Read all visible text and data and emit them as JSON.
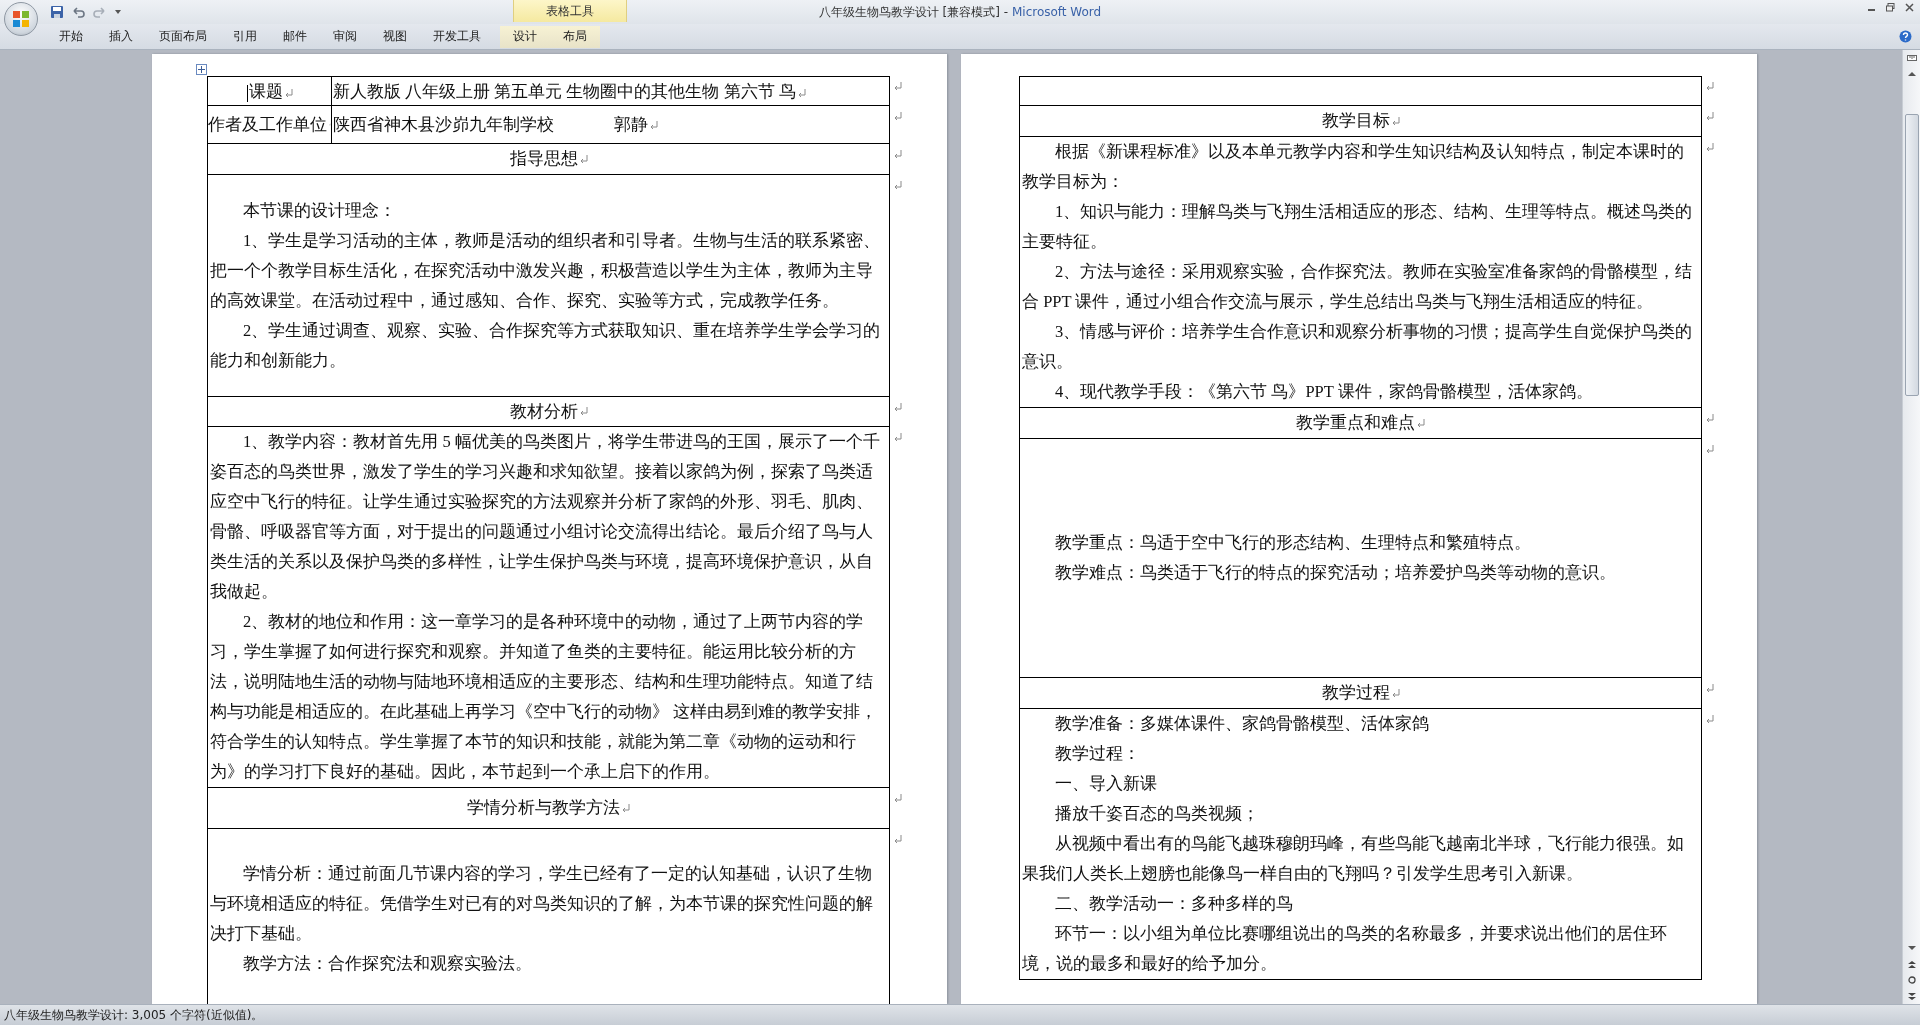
{
  "window": {
    "title": "八年级生物鸟教学设计 [兼容模式] -",
    "app_name": "Microsoft Word"
  },
  "ribbon": {
    "context_group": "表格工具",
    "tabs": [
      {
        "label": "开始",
        "contextual": false
      },
      {
        "label": "插入",
        "contextual": false
      },
      {
        "label": "页面布局",
        "contextual": false
      },
      {
        "label": "引用",
        "contextual": false
      },
      {
        "label": "邮件",
        "contextual": false
      },
      {
        "label": "审阅",
        "contextual": false
      },
      {
        "label": "视图",
        "contextual": false
      },
      {
        "label": "开发工具",
        "contextual": false
      },
      {
        "label": "设计",
        "contextual": true
      },
      {
        "label": "布局",
        "contextual": true
      }
    ]
  },
  "left_page": {
    "title_label": "课题",
    "title_value": "新人教版 八年级上册 第五单元 生物圈中的其他生物 第六节 鸟",
    "author_label": "作者及工作单位",
    "author_unit": "陕西省神木县沙峁九年制学校",
    "author_name": "郭静",
    "sections": [
      {
        "heading": "指导思想",
        "paragraphs": [
          "本节课的设计理念：",
          "1、学生是学习活动的主体，教师是活动的组织者和引导者。生物与生活的联系紧密、把一个个教学目标生活化，在探究活动中激发兴趣，积极营造以学生为主体，教师为主导的高效课堂。在活动过程中，通过感知、合作、探究、实验等方式，完成教学任务。",
          "2、学生通过调查、观察、实验、合作探究等方式获取知识、重在培养学生学会学习的能力和创新能力。"
        ]
      },
      {
        "heading": "教材分析",
        "paragraphs": [
          "1、教学内容：教材首先用 5 幅优美的鸟类图片，将学生带进鸟的王国，展示了一个千姿百态的鸟类世界，激发了学生的学习兴趣和求知欲望。接着以家鸽为例，探索了鸟类适应空中飞行的特征。让学生通过实验探究的方法观察并分析了家鸽的外形、羽毛、肌肉、骨骼、呼吸器官等方面，对于提出的问题通过小组讨论交流得出结论。最后介绍了鸟与人类生活的关系以及保护鸟类的多样性，让学生保护鸟类与环境，提高环境保护意识，从自我做起。",
          "2、教材的地位和作用：这一章学习的是各种环境中的动物，通过了上两节内容的学习，学生掌握了如何进行探究和观察。并知道了鱼类的主要特征。能运用比较分析的方法，说明陆地生活的动物与陆地环境相适应的主要形态、结构和生理功能特点。知道了结构与功能是相适应的。在此基础上再学习《空中飞行的动物》 这样由易到难的教学安排，符合学生的认知特点。学生掌握了本节的知识和技能，就能为第二章《动物的运动和行为》的学习打下良好的基础。因此，本节起到一个承上启下的作用。"
        ]
      },
      {
        "heading": "学情分析与教学方法",
        "paragraphs": [
          "学情分析：通过前面几节课内容的学习，学生已经有了一定的认知基础，认识了生物与环境相适应的特征。凭借学生对已有的对鸟类知识的了解，为本节课的探究性问题的解决打下基础。",
          "教学方法：合作探究法和观察实验法。"
        ]
      }
    ]
  },
  "right_page": {
    "sections": [
      {
        "heading": "教学目标",
        "paragraphs": [
          "根据《新课程标准》以及本单元教学内容和学生知识结构及认知特点，制定本课时的教学目标为：",
          "1、知识与能力：理解鸟类与飞翔生活相适应的形态、结构、生理等特点。概述鸟类的主要特征。",
          "2、方法与途径：采用观察实验，合作探究法。教师在实验室准备家鸽的骨骼模型，结合 PPT 课件，通过小组合作交流与展示，学生总结出鸟类与飞翔生活相适应的特征。",
          "3、情感与评价：培养学生合作意识和观察分析事物的习惯；提高学生自觉保护鸟类的意识。",
          "4、现代教学手段：《第六节 鸟》PPT 课件，家鸽骨骼模型，活体家鸽。"
        ]
      },
      {
        "heading": "教学重点和难点",
        "paragraphs": [
          "教学重点：鸟适于空中飞行的形态结构、生理特点和繁殖特点。",
          "教学难点：鸟类适于飞行的特点的探究活动；培养爱护鸟类等动物的意识。"
        ]
      },
      {
        "heading": "教学过程",
        "paragraphs": [
          "教学准备：多媒体课件、家鸽骨骼模型、活体家鸽",
          "教学过程：",
          "一、导入新课",
          "播放千姿百态的鸟类视频；",
          "从视频中看出有的鸟能飞越珠穆朗玛峰，有些鸟能飞越南北半球，飞行能力很强。如果我们人类长上翅膀也能像鸟一样自由的飞翔吗？引发学生思考引入新课。",
          "二、教学活动一：多种多样的鸟",
          "环节一：以小组为单位比赛哪组说出的鸟类的名称最多，并要求说出他们的居住环境，说的最多和最好的给予加分。"
        ]
      }
    ]
  },
  "status_bar": {
    "text": "八年级生物鸟教学设计: 3,005 个字符(近似值)。"
  }
}
